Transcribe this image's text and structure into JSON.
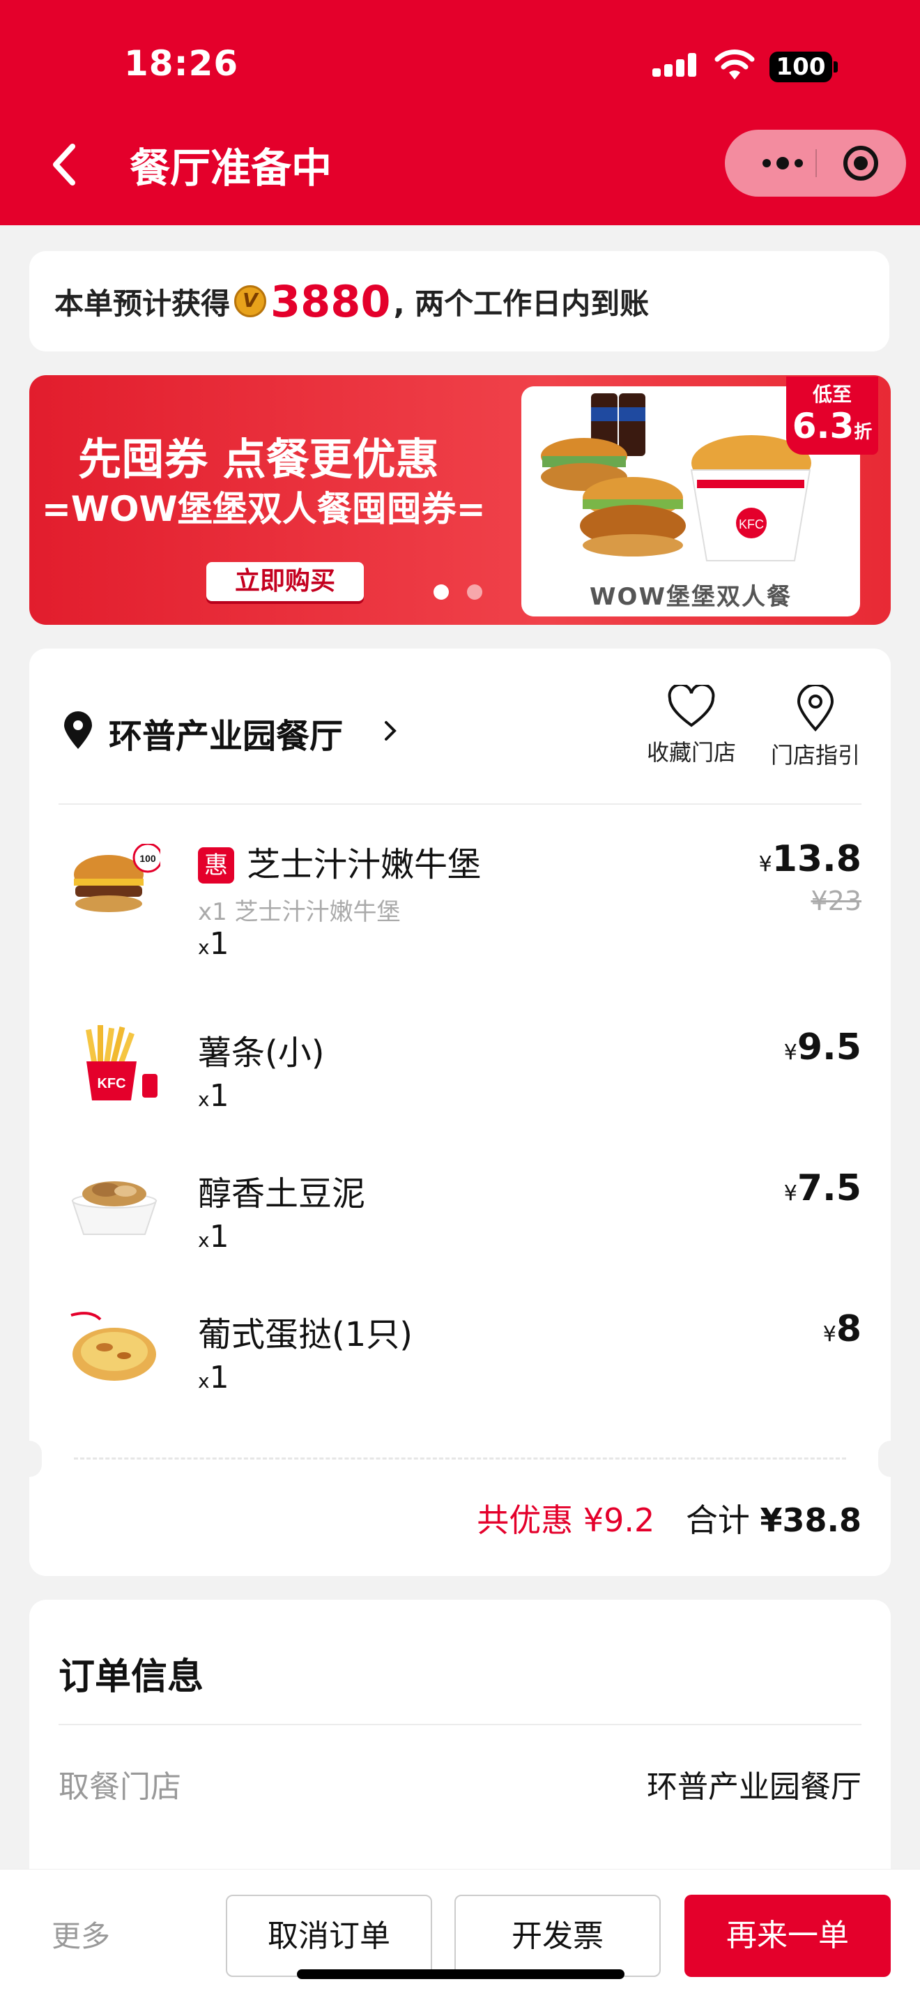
{
  "status": {
    "time": "18:26",
    "battery": "100"
  },
  "nav": {
    "title": "餐厅准备中"
  },
  "points": {
    "prefix": "本单预计获得",
    "coin_label": "V",
    "amount": "3880",
    "suffix": ", 两个工作日内到账"
  },
  "banner": {
    "line1": "先囤券 点餐更优惠",
    "line2": "=WOW堡堡双人餐囤囤券=",
    "button": "立即购买",
    "image_caption": "WOW堡堡双人餐",
    "tag_top": "低至",
    "tag_value": "6.3",
    "tag_unit": "折",
    "accent": "#e4002b"
  },
  "store": {
    "name": "环普产业园餐厅",
    "favorite_label": "收藏门店",
    "guide_label": "门店指引"
  },
  "items": [
    {
      "name": "芝士汁汁嫩牛堡",
      "badge": "惠",
      "sub": "x1 芝士汁汁嫩牛堡",
      "qty": "1",
      "currency": "¥",
      "price": "13.8",
      "original": "¥23"
    },
    {
      "name": "薯条(小)",
      "qty": "1",
      "currency": "¥",
      "price": "9.5"
    },
    {
      "name": "醇香土豆泥",
      "qty": "1",
      "currency": "¥",
      "price": "7.5"
    },
    {
      "name": "葡式蛋挞(1只)",
      "qty": "1",
      "currency": "¥",
      "price": "8"
    }
  ],
  "qty_prefix": "x",
  "totals": {
    "discount_label": "共优惠",
    "discount_value": "¥9.2",
    "sum_label": "合计",
    "sum_value": "¥38.8"
  },
  "info": {
    "title": "订单信息",
    "pickup_label": "取餐门店",
    "pickup_value": "环普产业园餐厅"
  },
  "bottom": {
    "more": "更多",
    "cancel": "取消订单",
    "invoice": "开发票",
    "reorder": "再来一单"
  }
}
